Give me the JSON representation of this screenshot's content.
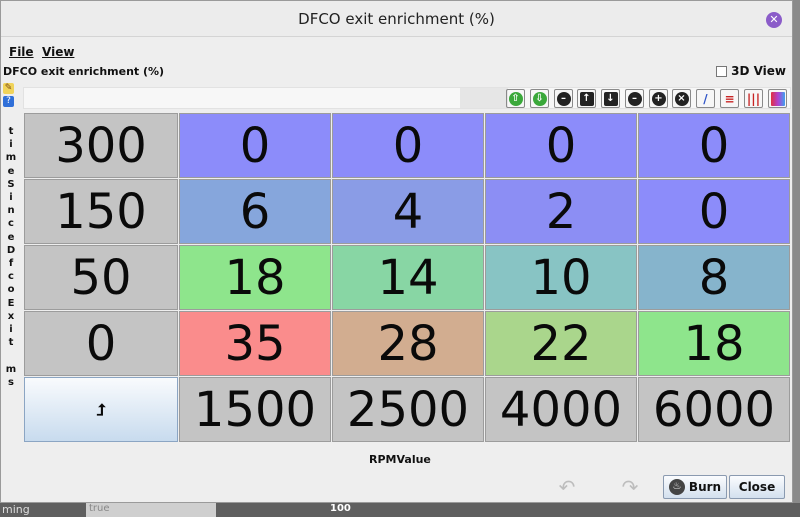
{
  "window": {
    "title": "DFCO exit enrichment (%)"
  },
  "menu": {
    "file": "File",
    "view": "View"
  },
  "panel": {
    "title": "DFCO exit enrichment (%)",
    "view3d_label": "3D View",
    "view3d_checked": false
  },
  "toolbar": {
    "buttons": [
      {
        "name": "shift-up-icon",
        "glyph": "⇧",
        "color": "#3aa83a"
      },
      {
        "name": "shift-down-icon",
        "glyph": "⇩",
        "color": "#3aa83a"
      },
      {
        "name": "decrement-icon",
        "glyph": "–",
        "color": "#222222"
      },
      {
        "name": "arrow-up-icon",
        "glyph": "↑",
        "color": "#222222"
      },
      {
        "name": "arrow-down-icon",
        "glyph": "↓",
        "color": "#222222"
      },
      {
        "name": "minus-icon",
        "glyph": "–",
        "color": "#222222"
      },
      {
        "name": "plus-icon",
        "glyph": "+",
        "color": "#222222"
      },
      {
        "name": "multiply-icon",
        "glyph": "×",
        "color": "#222222"
      },
      {
        "name": "pen-icon",
        "glyph": "/",
        "color": "#3055c8"
      },
      {
        "name": "horizontal-interpolate-icon",
        "glyph": "≡",
        "color": "#c82424"
      },
      {
        "name": "vertical-interpolate-icon",
        "glyph": "|||",
        "color": "#c82424"
      },
      {
        "name": "color-map-icon",
        "glyph": "",
        "color": "#c040c0"
      }
    ]
  },
  "y_axis": {
    "label": "timeSinceDfcoExit ms",
    "letters": [
      "t",
      "i",
      "m",
      "e",
      "S",
      "i",
      "n",
      "c",
      "e",
      "D",
      "f",
      "c",
      "o",
      "E",
      "x",
      "i",
      "t",
      "",
      "m",
      "s"
    ]
  },
  "x_axis": {
    "label": "RPMValue"
  },
  "table": {
    "row_headers": [
      "300",
      "150",
      "50",
      "0"
    ],
    "col_headers": [
      "1500",
      "2500",
      "4000",
      "6000"
    ],
    "values": [
      [
        "0",
        "0",
        "0",
        "0"
      ],
      [
        "6",
        "4",
        "2",
        "0"
      ],
      [
        "18",
        "14",
        "10",
        "8"
      ],
      [
        "35",
        "28",
        "22",
        "18"
      ]
    ],
    "colors": [
      [
        "#8c8cfa",
        "#8c8cfa",
        "#8c8cfa",
        "#8c8cfa"
      ],
      [
        "#86a6dc",
        "#8a9ce6",
        "#8c8ef4",
        "#8c8cfa"
      ],
      [
        "#8ee58c",
        "#88d6a4",
        "#88c4c4",
        "#86b4cc"
      ],
      [
        "#fa8c8c",
        "#d2ad90",
        "#aad68c",
        "#8ee58c"
      ]
    ]
  },
  "footer": {
    "burn_label": "Burn",
    "close_label": "Close"
  },
  "background": {
    "label_text": "ming",
    "field_text": "true",
    "gauge_text": "100"
  }
}
